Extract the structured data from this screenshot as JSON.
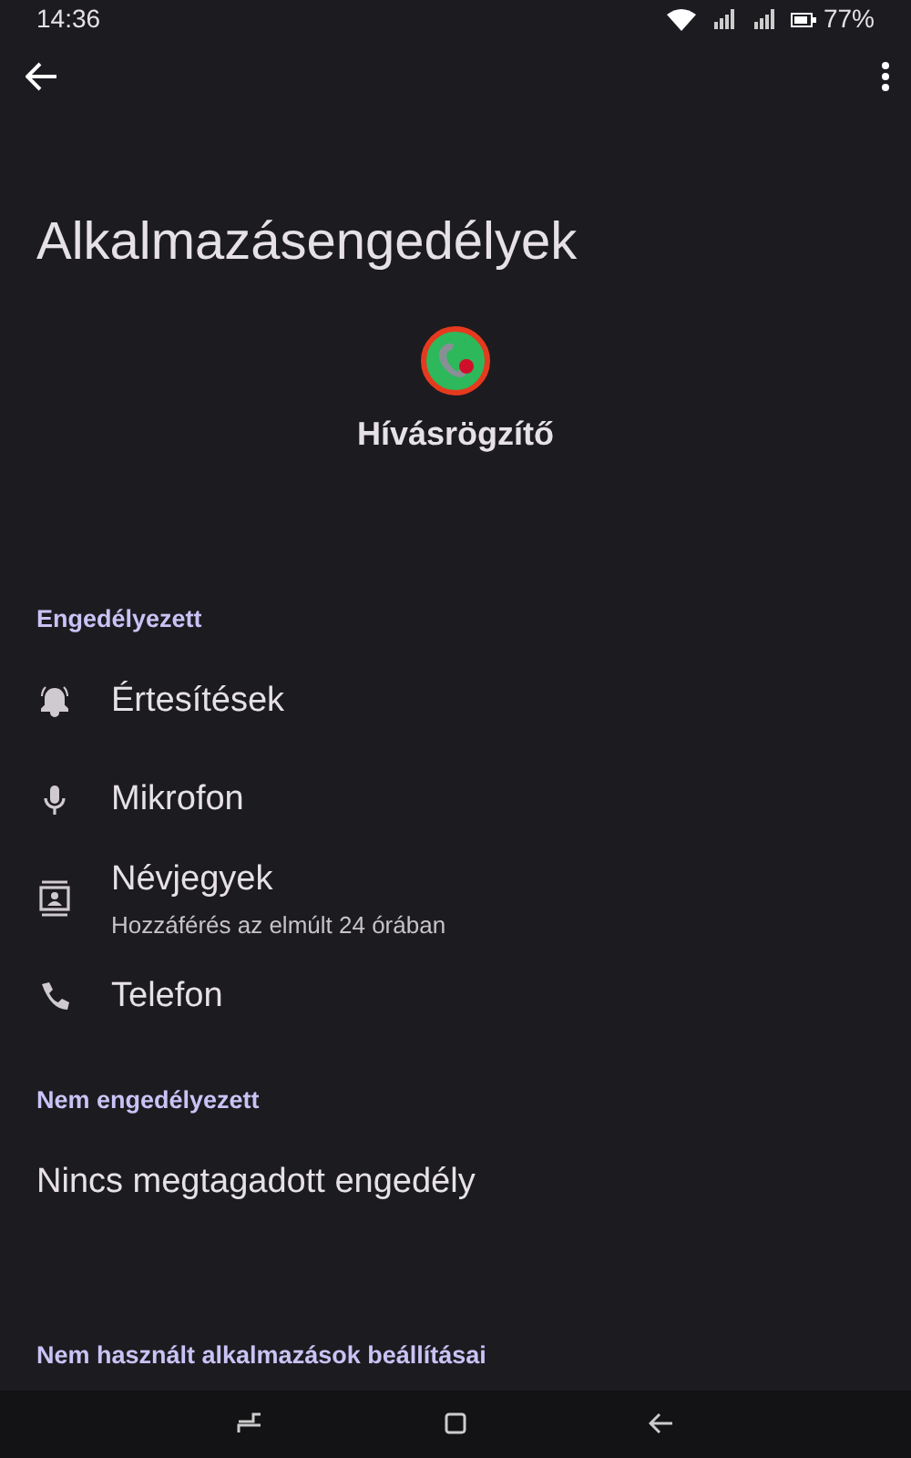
{
  "status_bar": {
    "time": "14:36",
    "battery": "77%"
  },
  "title": "Alkalmazásengedélyek",
  "app": {
    "name": "Hívásrögzítő"
  },
  "sections": [
    {
      "header": "Engedélyezett",
      "items": [
        {
          "kind": "bell",
          "label": "Értesítések"
        },
        {
          "kind": "mic",
          "label": "Mikrofon"
        },
        {
          "kind": "contacts",
          "label": "Névjegyek",
          "summary": "Hozzáférés az elmúlt 24 órában"
        },
        {
          "kind": "phone",
          "label": "Telefon"
        }
      ]
    },
    {
      "header": "Nem engedélyezett",
      "empty_text": "Nincs megtagadott engedély"
    },
    {
      "header": "Nem használt alkalmazások beállításai"
    }
  ]
}
